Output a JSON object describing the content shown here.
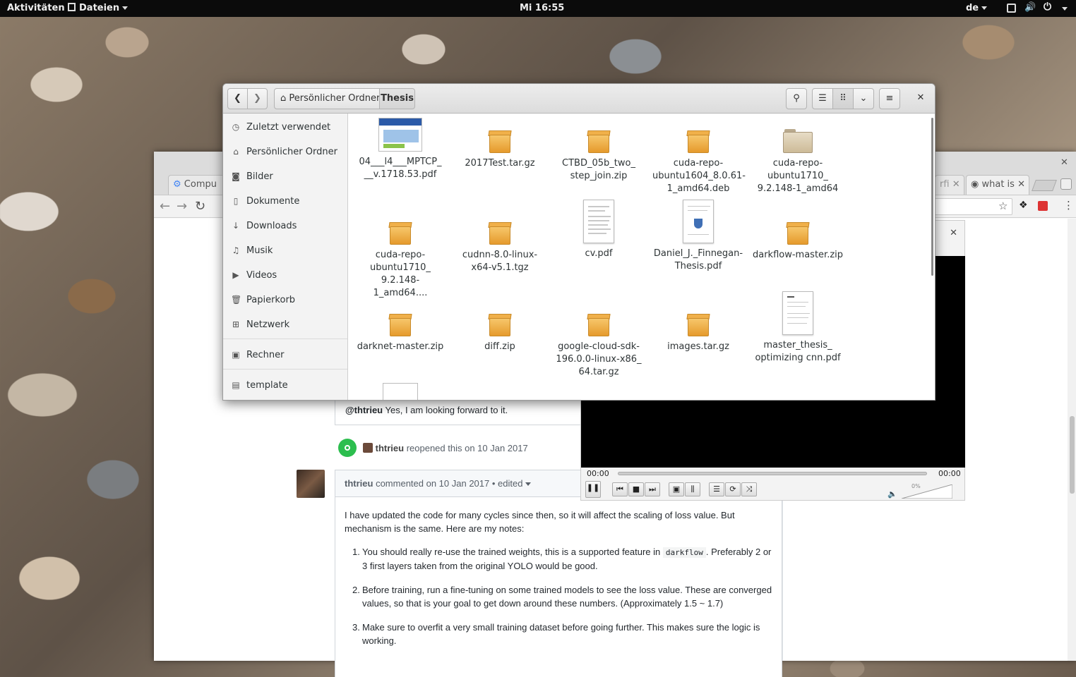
{
  "topbar": {
    "activities": "Aktivitäten",
    "app_menu": "Dateien",
    "clock": "Mi 16:55",
    "lang": "de"
  },
  "chrome": {
    "tabs": [
      {
        "label": "Compu"
      },
      {
        "label": "rfi"
      },
      {
        "label": "what is"
      }
    ]
  },
  "player": {
    "time_current": "00:00",
    "time_total": "00:00",
    "volume": "0%"
  },
  "github": {
    "comment1": {
      "author": "@thtrieu",
      "text": "Yes, I am looking forward to it."
    },
    "event": {
      "actor": "thtrieu",
      "text": "reopened this on 10 Jan 2017"
    },
    "comment2": {
      "author": "thtrieu",
      "meta": "commented on 10 Jan 2017",
      "edited": "• edited",
      "intro": "I have updated the code for many cycles since then, so it will affect the scaling of loss value. But mechanism is the same. Here are my notes:",
      "notes": [
        {
          "num": "1.",
          "pre": "You should really re-use the trained weights, this is a supported feature in",
          "code": "darkflow",
          "post": ". Preferably 2 or 3 first layers taken from the original YOLO would be good."
        },
        {
          "num": "2.",
          "pre": "Before training, run a fine-tuning on some trained models to see the loss value. These are converged values, so that is your goal to get down around these numbers. (Approximately 1.5 ~ 1.7)",
          "code": "",
          "post": ""
        },
        {
          "num": "3.",
          "pre": "Make sure to overfit a very small training dataset before going further. This makes sure the logic is working.",
          "code": "",
          "post": ""
        }
      ]
    }
  },
  "files": {
    "path": [
      {
        "label": "Persönlicher Ordner"
      },
      {
        "label": "Thesis"
      }
    ],
    "sidebar": [
      {
        "label": "Zuletzt verwendet",
        "icon": "clock-icon"
      },
      {
        "label": "Persönlicher Ordner",
        "icon": "home-icon"
      },
      {
        "label": "Bilder",
        "icon": "camera-icon"
      },
      {
        "label": "Dokumente",
        "icon": "document-icon"
      },
      {
        "label": "Downloads",
        "icon": "download-icon"
      },
      {
        "label": "Musik",
        "icon": "music-icon"
      },
      {
        "label": "Videos",
        "icon": "video-icon"
      },
      {
        "label": "Papierkorb",
        "icon": "trash-icon"
      },
      {
        "label": "Netzwerk",
        "icon": "network-icon"
      },
      {
        "label": "Rechner",
        "icon": "drive-icon"
      },
      {
        "label": "template",
        "icon": "folder-icon"
      }
    ],
    "items": [
      {
        "line1": "04___l4___MPTCP_",
        "line2": "__v.1718.53.pdf",
        "line3": "",
        "kind": "pdf-thumb"
      },
      {
        "line1": "2017Test.tar.gz",
        "line2": "",
        "line3": "",
        "kind": "archive"
      },
      {
        "line1": "CTBD_05b_two_",
        "line2": "step_join.zip",
        "line3": "",
        "kind": "archive"
      },
      {
        "line1": "cuda-repo-",
        "line2": "ubuntu1604_8.0.61-",
        "line3": "1_amd64.deb",
        "kind": "archive"
      },
      {
        "line1": "cuda-repo-",
        "line2": "ubuntu1710_",
        "line3": "9.2.148-1_amd64",
        "kind": "folder"
      },
      {
        "line1": "cuda-repo-",
        "line2": "ubuntu1710_",
        "line3": "9.2.148-1_amd64....",
        "kind": "archive"
      },
      {
        "line1": "cudnn-8.0-linux-",
        "line2": "x64-v5.1.tgz",
        "line3": "",
        "kind": "archive"
      },
      {
        "line1": "cv.pdf",
        "line2": "",
        "line3": "",
        "kind": "doc"
      },
      {
        "line1": "Daniel_J._Finnegan-",
        "line2": "Thesis.pdf",
        "line3": "",
        "kind": "doc"
      },
      {
        "line1": "darkflow-master.zip",
        "line2": "",
        "line3": "",
        "kind": "archive"
      },
      {
        "line1": "darknet-master.zip",
        "line2": "",
        "line3": "",
        "kind": "archive"
      },
      {
        "line1": "diff.zip",
        "line2": "",
        "line3": "",
        "kind": "archive"
      },
      {
        "line1": "google-cloud-sdk-",
        "line2": "196.0.0-linux-x86_",
        "line3": "64.tar.gz",
        "kind": "archive"
      },
      {
        "line1": "images.tar.gz",
        "line2": "",
        "line3": "",
        "kind": "archive"
      },
      {
        "line1": "master_thesis_",
        "line2": "optimizing cnn.pdf",
        "line3": "",
        "kind": "doc"
      }
    ]
  }
}
